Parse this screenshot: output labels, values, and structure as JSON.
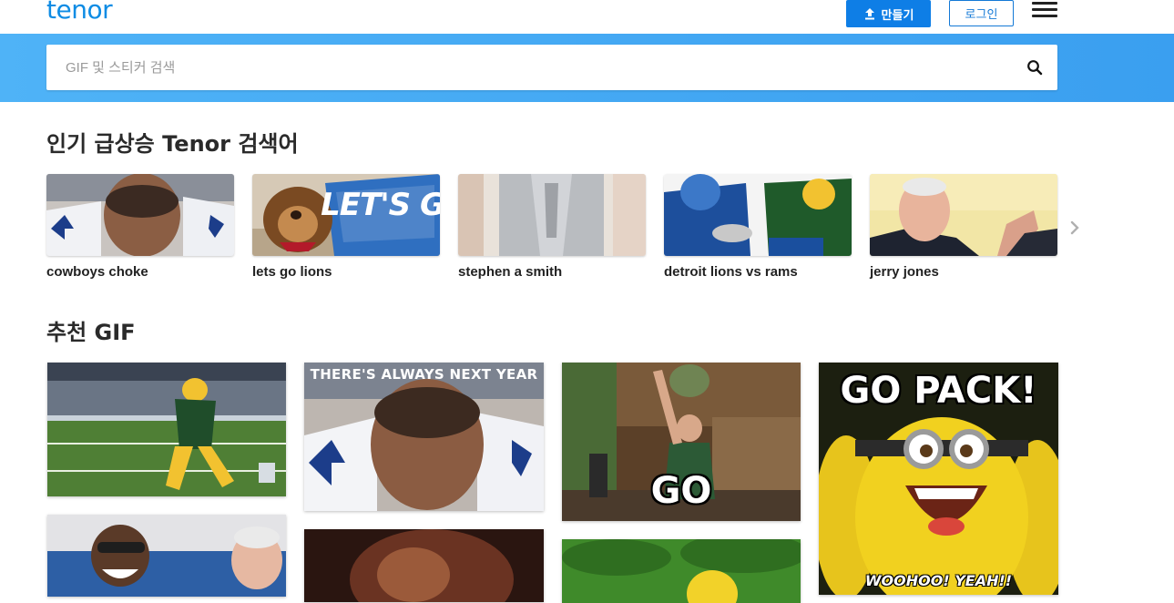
{
  "header": {
    "logo": "tenor",
    "create_label": "만들기",
    "login_label": "로그인"
  },
  "search": {
    "placeholder": "GIF 및 스티커 검색",
    "value": ""
  },
  "trending": {
    "title": "인기 급상승 Tenor 검색어",
    "items": [
      {
        "label": "cowboys choke"
      },
      {
        "label": "lets go lions"
      },
      {
        "label": "stephen a smith"
      },
      {
        "label": "detroit lions vs rams"
      },
      {
        "label": "jerry jones"
      }
    ]
  },
  "recommended": {
    "title": "추천 GIF",
    "captions": {
      "next_year": "THERE'S ALWAYS NEXT YEAR",
      "go": "GO",
      "go_pack": "GO PACK!",
      "woohoo": "WOOHOO! YEAH!!"
    }
  },
  "colors": {
    "brand": "#0e8ce4",
    "create_button": "#0e7ee6",
    "search_band": "#4fb3f7"
  }
}
